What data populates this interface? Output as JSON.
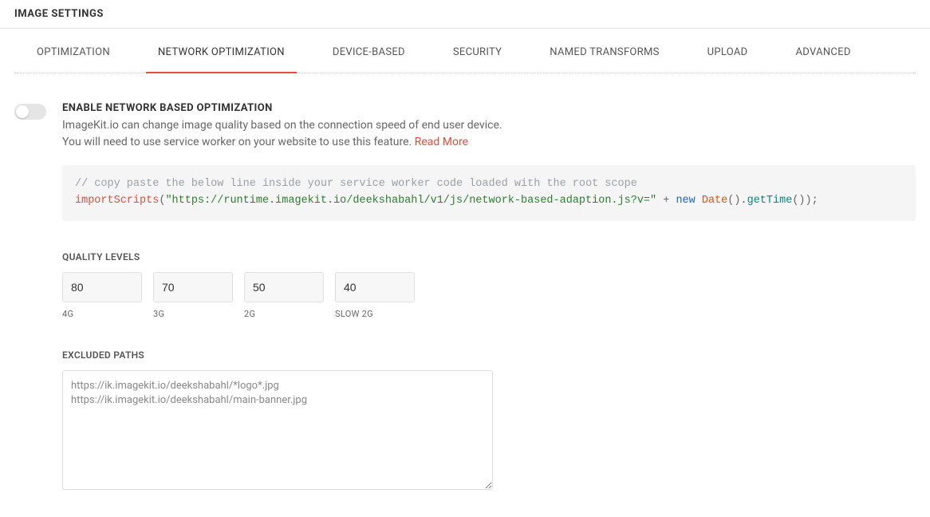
{
  "header": {
    "title": "IMAGE SETTINGS"
  },
  "tabs": [
    {
      "label": "OPTIMIZATION",
      "active": false
    },
    {
      "label": "NETWORK OPTIMIZATION",
      "active": true
    },
    {
      "label": "DEVICE-BASED",
      "active": false
    },
    {
      "label": "SECURITY",
      "active": false
    },
    {
      "label": "NAMED TRANSFORMS",
      "active": false
    },
    {
      "label": "UPLOAD",
      "active": false
    },
    {
      "label": "ADVANCED",
      "active": false
    }
  ],
  "networkOpt": {
    "toggle_on": false,
    "title": "ENABLE NETWORK BASED OPTIMIZATION",
    "desc_line1": "ImageKit.io can change image quality based on the connection speed of end user device.",
    "desc_line2": "You will need to use service worker on your website to use this feature. ",
    "read_more": "Read More",
    "code": {
      "comment": "// copy paste the below line inside your service worker code loaded with the root scope",
      "func": "importScripts",
      "paren_open": "(",
      "str": "\"https://runtime.imagekit.io/deekshabahl/v1/js/network-based-adaption.js?v=\"",
      "plus": " + ",
      "kw_new": "new",
      "type_date": " Date",
      "call1": "().",
      "method": "getTime",
      "tail": "());"
    },
    "quality": {
      "label": "QUALITY LEVELS",
      "levels": [
        {
          "value": "80",
          "caption": "4G"
        },
        {
          "value": "70",
          "caption": "3G"
        },
        {
          "value": "50",
          "caption": "2G"
        },
        {
          "value": "40",
          "caption": "SLOW 2G"
        }
      ]
    },
    "excluded": {
      "label": "EXCLUDED PATHS",
      "value": "https://ik.imagekit.io/deekshabahl/*logo*.jpg\nhttps://ik.imagekit.io/deekshabahl/main-banner.jpg"
    }
  }
}
